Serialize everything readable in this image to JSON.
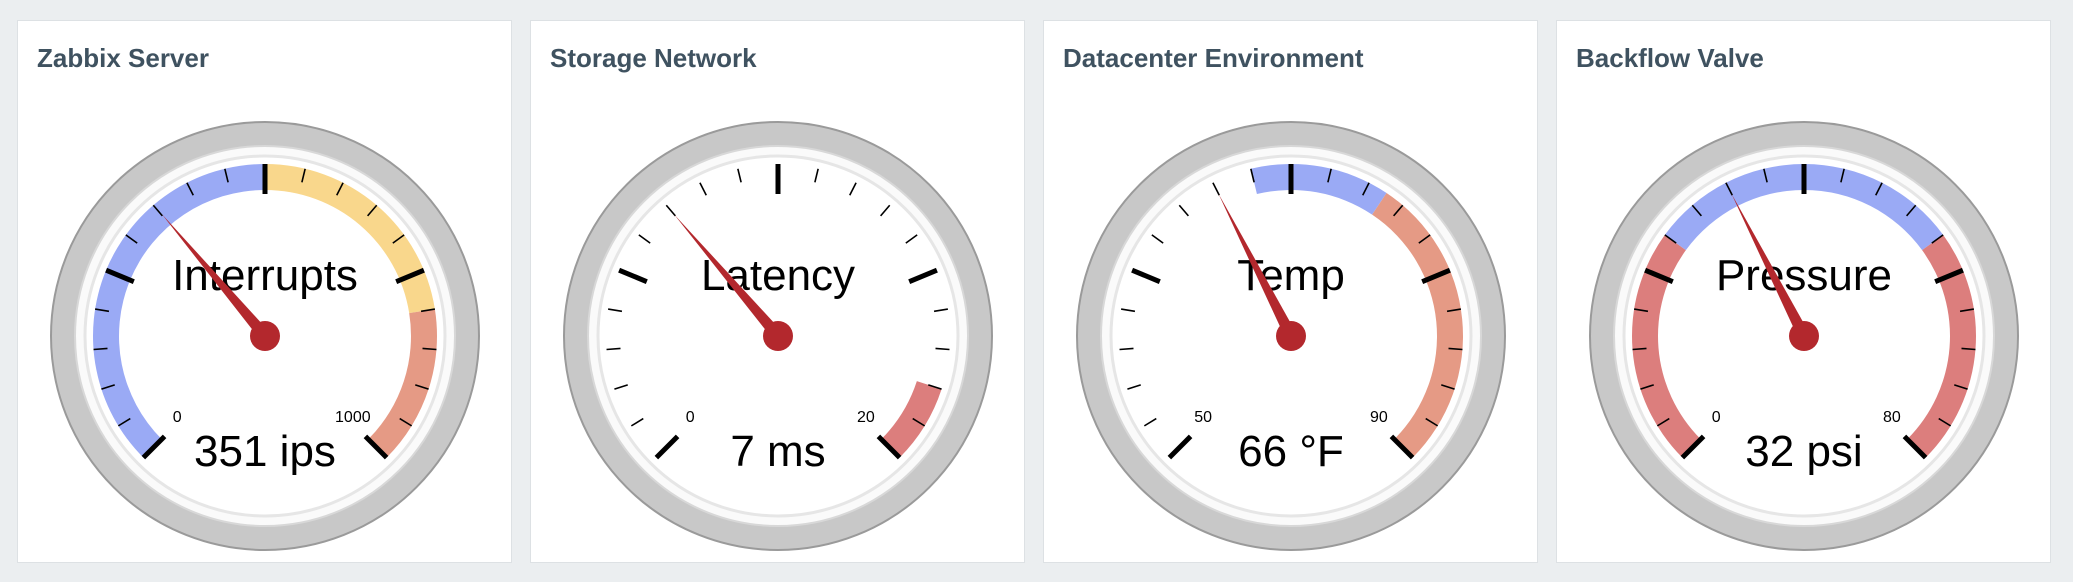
{
  "colors": {
    "background": "#ebeef0",
    "panel": "#ffffff",
    "title": "#3f5260",
    "needle": "#b3282d",
    "blue_band": "#9aaaf5",
    "yellow_band": "#f9d78c",
    "orange_band": "#e59a85",
    "red_band": "#dc7e7d"
  },
  "gauges": [
    {
      "panel_title": "Zabbix Server",
      "label": "Interrupts",
      "value": 351,
      "value_text": "351 ips",
      "min": 0,
      "max": 1000,
      "min_label": "0",
      "max_label": "1000",
      "bands": [
        {
          "from": 0,
          "to": 500,
          "color": "#9aaaf5"
        },
        {
          "from": 500,
          "to": 800,
          "color": "#f9d78c"
        },
        {
          "from": 800,
          "to": 1000,
          "color": "#e59a85"
        }
      ]
    },
    {
      "panel_title": "Storage Network",
      "label": "Latency",
      "value": 7,
      "value_text": "7 ms",
      "min": 0,
      "max": 20,
      "min_label": "0",
      "max_label": "20",
      "bands": [
        {
          "from": 18,
          "to": 20,
          "color": "#dc7e7d"
        }
      ]
    },
    {
      "panel_title": "Datacenter Environment",
      "label": "Temp",
      "value": 66,
      "value_text": "66 °F",
      "min": 50,
      "max": 90,
      "min_label": "50",
      "max_label": "90",
      "bands": [
        {
          "from": 68,
          "to": 75,
          "color": "#9aaaf5"
        },
        {
          "from": 75,
          "to": 90,
          "color": "#e59a85"
        }
      ]
    },
    {
      "panel_title": "Backflow Valve",
      "label": "Pressure",
      "value": 32,
      "value_text": "32 psi",
      "min": 0,
      "max": 80,
      "min_label": "0",
      "max_label": "80",
      "bands": [
        {
          "from": 0,
          "to": 24,
          "color": "#dc7e7d"
        },
        {
          "from": 24,
          "to": 56,
          "color": "#9aaaf5"
        },
        {
          "from": 56,
          "to": 80,
          "color": "#dc7e7d"
        }
      ]
    }
  ]
}
